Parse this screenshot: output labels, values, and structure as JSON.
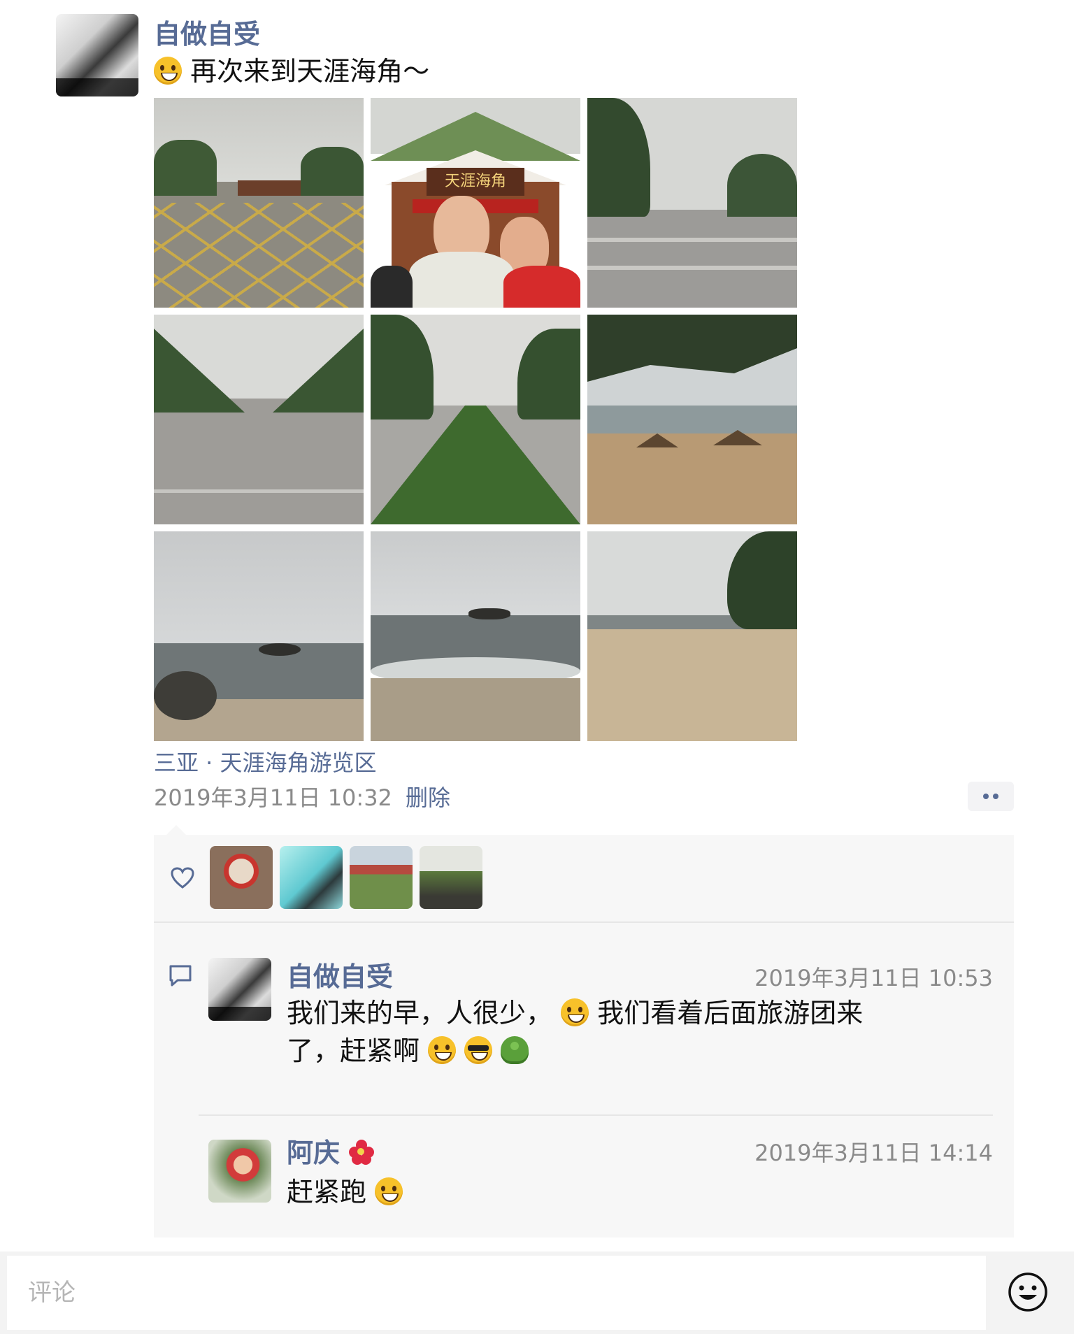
{
  "post": {
    "author": "自做自受",
    "text": "再次来到天涯海角～",
    "location": "三亚 · 天涯海角游览区",
    "time": "2019年3月11日 10:32",
    "delete_label": "删除",
    "photos": [
      "plaza-with-cones",
      "tianya-haijiao-gate-couple",
      "palm-avenue",
      "palm-avenue-people",
      "flower-bed-walkway",
      "beach-umbrellas",
      "sea-rocks-waves",
      "sea-waves",
      "sandy-beach"
    ],
    "gate_sign": "天涯海角"
  },
  "likes": {
    "icon": "heart-icon",
    "avatars": [
      "liker-avatar-1",
      "liker-avatar-2",
      "liker-avatar-3",
      "liker-avatar-4"
    ]
  },
  "comments": [
    {
      "author": "自做自受",
      "time": "2019年3月11日 10:53",
      "text_part1": "我们来的早，人很少，",
      "text_part2": "我们看着后面旅游团来",
      "text_part3": "了，赶紧啊"
    },
    {
      "author": "阿庆",
      "time": "2019年3月11日 14:14",
      "text": "赶紧跑"
    }
  ],
  "input": {
    "placeholder": "评论",
    "emoji_button": "smiley-icon"
  },
  "colors": {
    "name": "#576b95",
    "panel": "#f7f7f7",
    "muted": "#8a8a8a"
  }
}
